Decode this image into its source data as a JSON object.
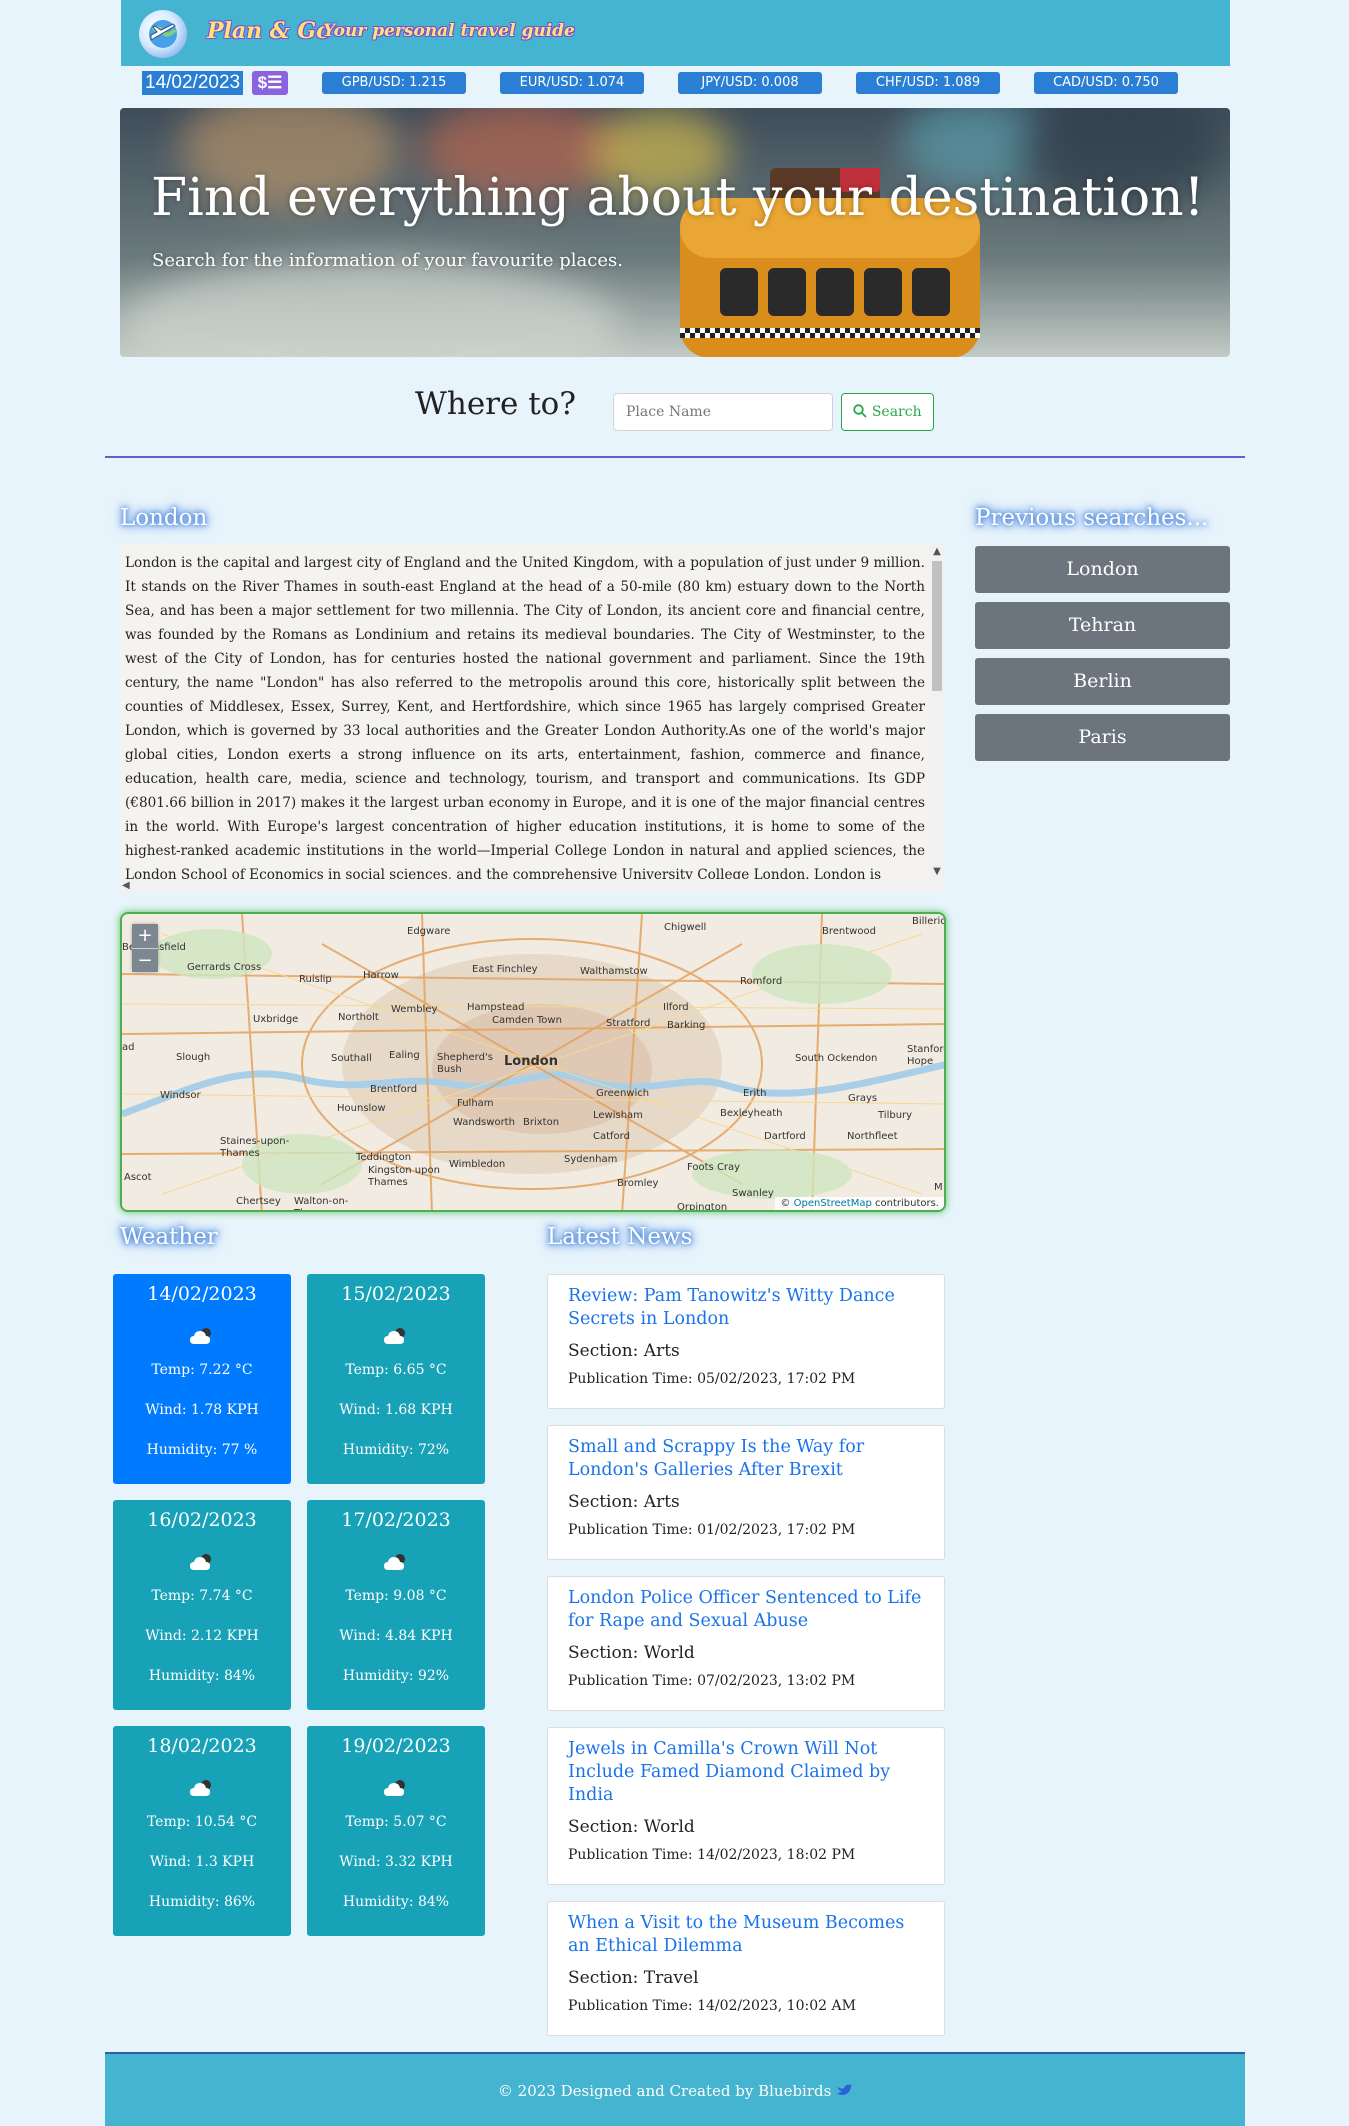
{
  "header": {
    "brand": "Plan & Go",
    "tagline": "Your personal travel guide"
  },
  "rates_bar": {
    "date": "14/02/2023",
    "toggle_symbol": "$☰",
    "rates": [
      "GPB/USD: 1.215",
      "EUR/USD: 1.074",
      "JPY/USD: 0.008",
      "CHF/USD: 1.089",
      "CAD/USD: 0.750"
    ]
  },
  "hero": {
    "title": "Find everything about your destination!",
    "subtitle": "Search for the information of your favourite places."
  },
  "search": {
    "label": "Where to?",
    "placeholder": "Place Name",
    "button": "Search"
  },
  "place": {
    "name": "London",
    "description": "London is the capital and largest city of England and the United Kingdom, with a population of just under 9 million. It stands on the River Thames in south-east England at the head of a 50-mile (80 km) estuary down to the North Sea, and has been a major settlement for two millennia. The City of London, its ancient core and financial centre, was founded by the Romans as Londinium and retains its medieval boundaries. The City of Westminster, to the west of the City of London, has for centuries hosted the national government and parliament. Since the 19th century, the name \"London\" has also referred to the metropolis around this core, historically split between the counties of Middlesex, Essex, Surrey, Kent, and Hertfordshire, which since 1965 has largely comprised Greater London, which is governed by 33 local authorities and the Greater London Authority.As one of the world's major global cities, London exerts a strong influence on its arts, entertainment, fashion, commerce and finance, education, health care, media, science and technology, tourism, and transport and communications. Its GDP (€801.66 billion in 2017) makes it the largest urban economy in Europe, and it is one of the major financial centres in the world. With Europe's largest concentration of higher education institutions, it is home to some of the highest-ranked academic institutions in the world—Imperial College London in natural and applied sciences, the London School of Economics in social sciences, and the comprehensive University College London. London is"
  },
  "map": {
    "zoom_in": "+",
    "zoom_out": "−",
    "attribution_prefix": "©",
    "attribution_link": "OpenStreetMap",
    "attribution_suffix": "contributors.",
    "labels": [
      "Edgware",
      "Chigwell",
      "Brentwood",
      "Billericay",
      "Gerrards Cross",
      "Ruislip",
      "Harrow",
      "East Finchley",
      "Walthamstow",
      "Romford",
      "Uxbridge",
      "Northolt",
      "Wembley",
      "Hampstead",
      "Camden Town",
      "Ilford",
      "Stratford",
      "Barking",
      "Slough",
      "Southall",
      "Ealing",
      "Shepherd's Bush",
      "London",
      "South Ockendon",
      "Stanford Hope",
      "Windsor",
      "Brentford",
      "Fulham",
      "Greenwich",
      "Erith",
      "Grays",
      "Hounslow",
      "Wandsworth",
      "Brixton",
      "Lewisham",
      "Bexleyheath",
      "Tilbury",
      "Staines-upon-Thames",
      "Teddington",
      "Catford",
      "Dartford",
      "Northfleet",
      "Kingston upon Thames",
      "Wimbledon",
      "Sydenham",
      "Foots Cray",
      "Ascot",
      "Bromley",
      "Swanley",
      "Chertsey",
      "Walton-on-Thames",
      "Orpington",
      "Beaconsfield",
      "ad",
      "M"
    ]
  },
  "weather": {
    "heading": "Weather",
    "days": [
      {
        "date": "14/02/2023",
        "temp": "Temp: 7.22 °C",
        "wind": "Wind: 1.78 KPH",
        "humidity": "Humidity: 77 %"
      },
      {
        "date": "15/02/2023",
        "temp": "Temp: 6.65 °C",
        "wind": "Wind: 1.68 KPH",
        "humidity": "Humidity: 72%"
      },
      {
        "date": "16/02/2023",
        "temp": "Temp: 7.74 °C",
        "wind": "Wind: 2.12 KPH",
        "humidity": "Humidity: 84%"
      },
      {
        "date": "17/02/2023",
        "temp": "Temp: 9.08 °C",
        "wind": "Wind: 4.84 KPH",
        "humidity": "Humidity: 92%"
      },
      {
        "date": "18/02/2023",
        "temp": "Temp: 10.54 °C",
        "wind": "Wind: 1.3 KPH",
        "humidity": "Humidity: 86%"
      },
      {
        "date": "19/02/2023",
        "temp": "Temp: 5.07 °C",
        "wind": "Wind: 3.32 KPH",
        "humidity": "Humidity: 84%"
      }
    ],
    "icon": "cloud-icon"
  },
  "news": {
    "heading": "Latest News",
    "items": [
      {
        "title": "Review: Pam Tanowitz's Witty Dance Secrets in London",
        "section": "Section: Arts",
        "time": "Publication Time: 05/02/2023, 17:02 PM"
      },
      {
        "title": "Small and Scrappy Is the Way for London's Galleries After Brexit",
        "section": "Section: Arts",
        "time": "Publication Time: 01/02/2023, 17:02 PM"
      },
      {
        "title": "London Police Officer Sentenced to Life for Rape and Sexual Abuse",
        "section": "Section: World",
        "time": "Publication Time: 07/02/2023, 13:02 PM"
      },
      {
        "title": "Jewels in Camilla's Crown Will Not Include Famed Diamond Claimed by India",
        "section": "Section: World",
        "time": "Publication Time: 14/02/2023, 18:02 PM"
      },
      {
        "title": "When a Visit to the Museum Becomes an Ethical Dilemma",
        "section": "Section: Travel",
        "time": "Publication Time: 14/02/2023, 10:02 AM"
      }
    ]
  },
  "previous": {
    "heading": "Previous searches...",
    "items": [
      "London",
      "Tehran",
      "Berlin",
      "Paris"
    ]
  },
  "footer": {
    "text": "© 2023 Designed and Created by Bluebirds"
  },
  "colors": {
    "header_bg": "#44b4d0",
    "rate_badge": "#2a7fd4",
    "weather_today": "#007bff",
    "weather_card": "#17a2b8",
    "sidebar_button": "#6c757d",
    "search_button": "#28a745",
    "news_link": "#1a73e8"
  }
}
